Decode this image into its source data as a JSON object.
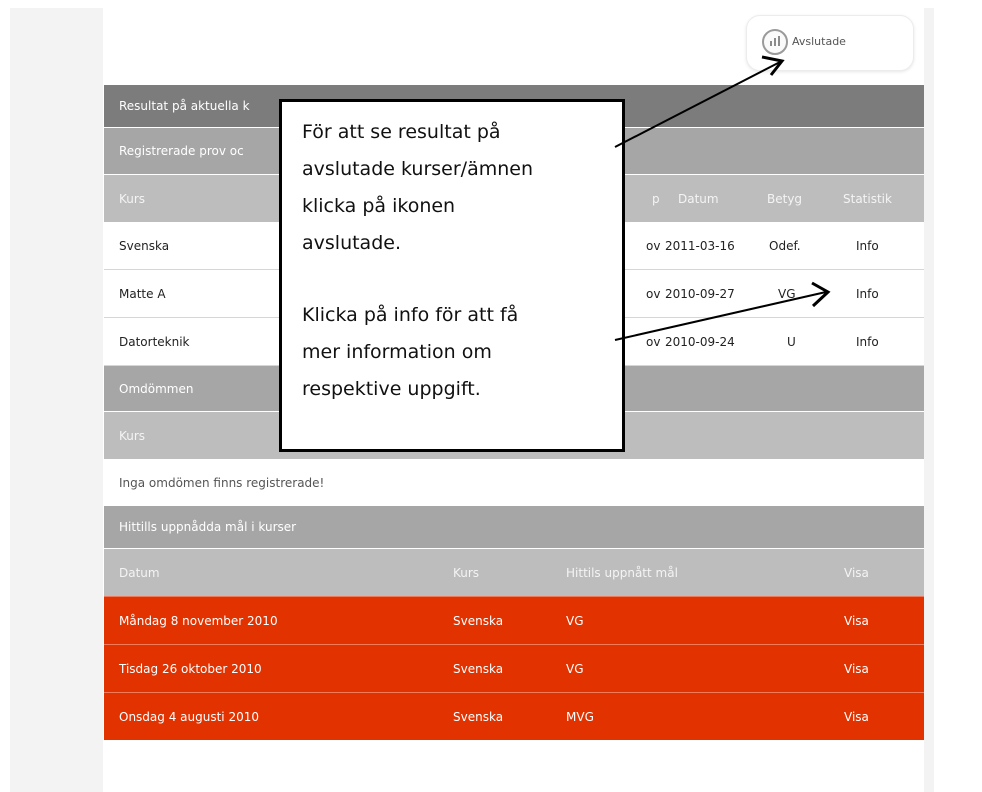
{
  "avslutade": {
    "label": "Avslutade",
    "icon": "bar-chart-icon"
  },
  "results_bar": {
    "title": "Resultat på aktuella k"
  },
  "registered_bar": {
    "title": "Registrerade prov oc"
  },
  "results_table": {
    "headers": {
      "kurs": "Kurs",
      "typ": "p",
      "datum": "Datum",
      "betyg": "Betyg",
      "statistik": "Statistik"
    },
    "rows": [
      {
        "kurs": "Svenska",
        "typ": "ov",
        "datum": "2011-03-16",
        "betyg": "Odef.",
        "statistik": "Info"
      },
      {
        "kurs": "Matte A",
        "typ": "ov",
        "datum": "2010-09-27",
        "betyg": "VG",
        "statistik": "Info"
      },
      {
        "kurs": "Datorteknik",
        "typ": "ov",
        "datum": "2010-09-24",
        "betyg": "U",
        "statistik": "Info"
      }
    ]
  },
  "omdommen": {
    "title": "Omdömmen",
    "header_kurs": "Kurs",
    "empty_message": "Inga omdömen finns registrerade!"
  },
  "goals": {
    "title": "Hittills uppnådda mål i kurser",
    "headers": {
      "datum": "Datum",
      "kurs": "Kurs",
      "mal": "Hittils uppnått mål",
      "visa": "Visa"
    },
    "rows": [
      {
        "datum": "Måndag 8 november 2010",
        "kurs": "Svenska",
        "mal": "VG",
        "visa": "Visa"
      },
      {
        "datum": "Tisdag 26 oktober 2010",
        "kurs": "Svenska",
        "mal": "VG",
        "visa": "Visa"
      },
      {
        "datum": "Onsdag 4 augusti 2010",
        "kurs": "Svenska",
        "mal": "MVG",
        "visa": "Visa"
      }
    ]
  },
  "callout": {
    "lines_1": [
      "För att se resultat på",
      "avslutade kurser/ämnen",
      "klicka på ikonen",
      "avslutade."
    ],
    "lines_2": [
      "Klicka på info för att få",
      "mer information om",
      "respektive uppgift."
    ]
  },
  "colors": {
    "red_row": "#e23200",
    "dark_bar": "#7c7c7c",
    "mid_bar": "#a6a6a6",
    "light_bar": "#bdbdbd"
  }
}
